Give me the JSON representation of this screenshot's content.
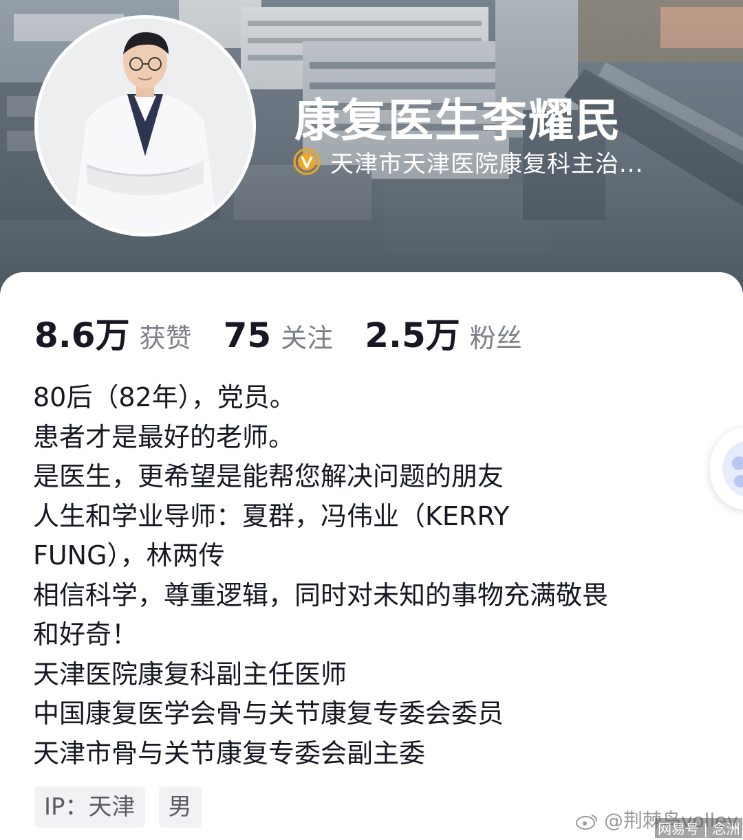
{
  "header": {
    "name": "康复医生李耀民",
    "verification": "天津市天津医院康复科主治..."
  },
  "stats": [
    {
      "value": "8.6万",
      "label": "获赞"
    },
    {
      "value": "75",
      "label": "关注"
    },
    {
      "value": "2.5万",
      "label": "粉丝"
    }
  ],
  "bio": [
    "80后（82年），党员。",
    "患者才是最好的老师。",
    "是医生，更希望是能帮您解决问题的朋友",
    "人生和学业导师：夏群，冯伟业（KERRY",
    "FUNG），林两传",
    "相信科学，尊重逻辑，同时对未知的事物充满敬畏",
    "和好奇！",
    "天津医院康复科副主任医师",
    "中国康复医学会骨与关节康复专委会委员",
    "天津市骨与关节康复专委会副主委"
  ],
  "tags": [
    "IP：天津",
    "男"
  ],
  "watermark": {
    "weibo": "@荆棘鸟volley",
    "netease": "网易号 | 念洲"
  },
  "icons": {
    "verify": "verified-badge-icon",
    "watermark": "weibo-logo-icon"
  },
  "colors": {
    "verify_badge": "#f0a623",
    "text_primary": "#161823",
    "text_secondary": "#7c7f86"
  }
}
